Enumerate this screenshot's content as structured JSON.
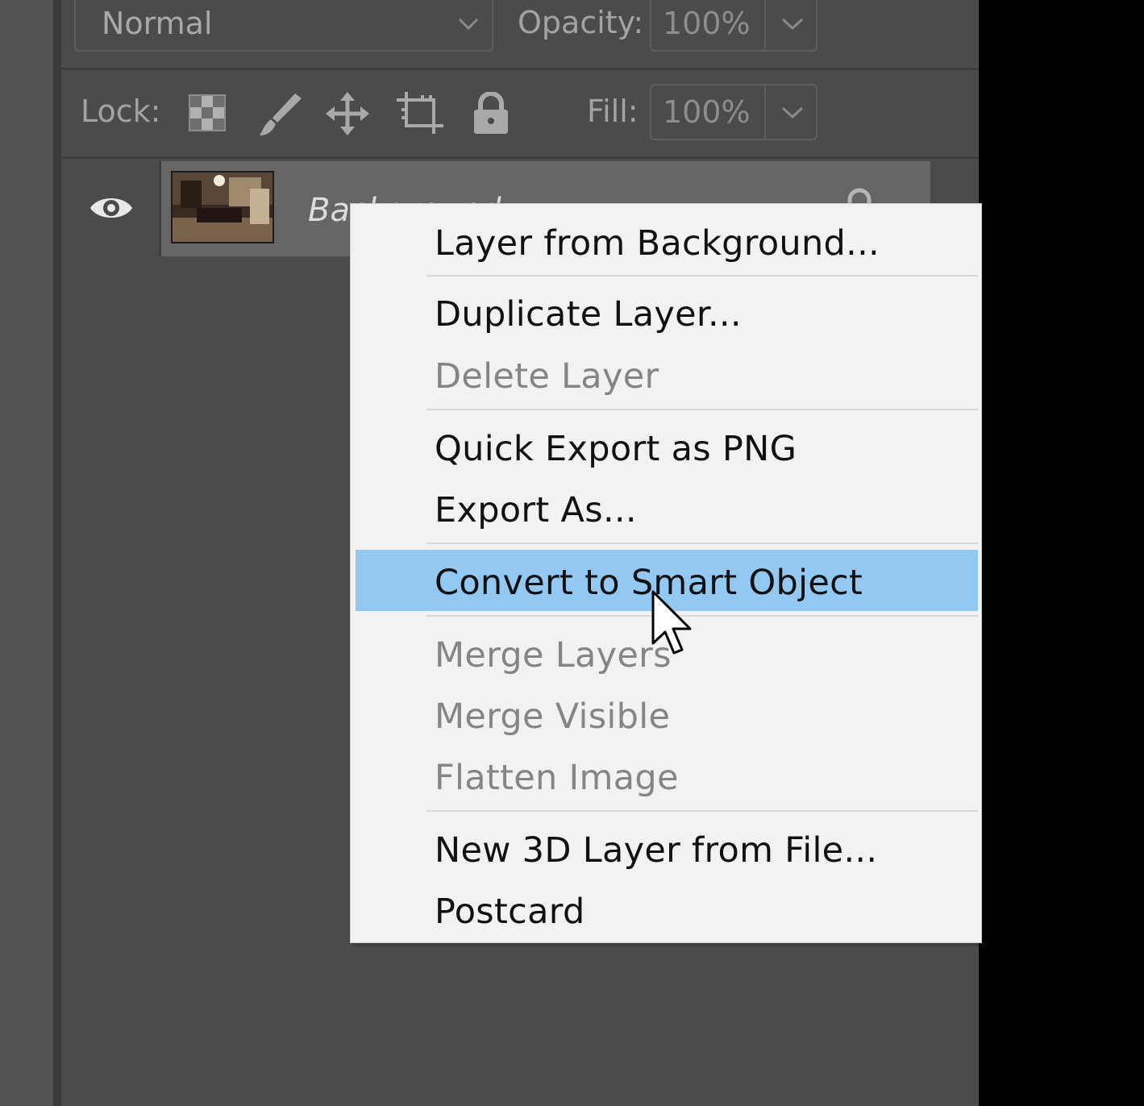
{
  "layers_panel": {
    "blend_mode": "Normal",
    "opacity_label": "Opacity:",
    "opacity_value": "100%",
    "lock_label": "Lock:",
    "fill_label": "Fill:",
    "fill_value": "100%",
    "lock_icons": [
      "lock-transparent-pixels-icon",
      "lock-image-pixels-icon",
      "lock-position-icon",
      "lock-artboard-icon",
      "lock-all-icon"
    ],
    "layer": {
      "name": "Background",
      "visible": true,
      "locked": true
    }
  },
  "context_menu": {
    "items": [
      {
        "label": "Layer from Background...",
        "enabled": true
      },
      {
        "label": "Duplicate Layer...",
        "enabled": true
      },
      {
        "label": "Delete Layer",
        "enabled": false
      },
      {
        "label": "Quick Export as PNG",
        "enabled": true
      },
      {
        "label": "Export As...",
        "enabled": true
      },
      {
        "label": "Convert to Smart Object",
        "enabled": true,
        "highlighted": true
      },
      {
        "label": "Merge Layers",
        "enabled": false
      },
      {
        "label": "Merge Visible",
        "enabled": false
      },
      {
        "label": "Flatten Image",
        "enabled": false
      },
      {
        "label": "New 3D Layer from File...",
        "enabled": true
      },
      {
        "label": "Postcard",
        "enabled": true
      }
    ]
  },
  "colors": {
    "panel_bg": "#4b4b4b",
    "menu_bg": "#f2f2f3",
    "menu_highlight": "#93c8f3",
    "disabled_text": "#858585"
  }
}
